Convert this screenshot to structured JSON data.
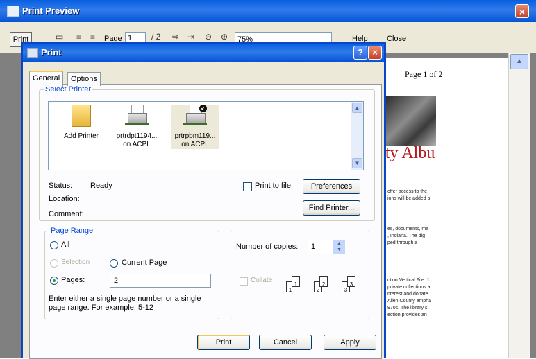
{
  "preview_window": {
    "title": "Print Preview",
    "toolbar": {
      "print_label": "Print",
      "page_label": "Page",
      "page_value": "1",
      "zoom_value": "75%",
      "help_label": "Help",
      "close_label": "Close"
    },
    "page": {
      "header": "Page 1 of 2",
      "title_fragment": "ty Albu",
      "paragraphs": [
        "offer access to the\nions will be added a",
        "es, documents, ma\n, Indiana. The dig\nped through a",
        "ction Vertical File. 1\nprivate collections a\nnterest and donate\nAllen County empha\n970s. The library s\nection provides an"
      ]
    }
  },
  "dialog": {
    "title": "Print",
    "tabs": [
      "General",
      "Options"
    ],
    "select_printer": {
      "legend": "Select Printer",
      "printers": [
        {
          "name": "Add Printer",
          "sub": ""
        },
        {
          "name": "prtrdpt1194...",
          "sub": "on ACPL"
        },
        {
          "name": "prtrpbm119...",
          "sub": "on ACPL"
        }
      ],
      "status_label": "Status:",
      "status_value": "Ready",
      "location_label": "Location:",
      "comment_label": "Comment:",
      "print_to_file_label": "Print to file",
      "preferences_label": "Preferences",
      "find_printer_label": "Find Printer..."
    },
    "page_range": {
      "legend": "Page Range",
      "all_label": "All",
      "selection_label": "Selection",
      "current_page_label": "Current Page",
      "pages_label": "Pages:",
      "pages_value": "2",
      "hint": "Enter either a single page number or a single page range.  For example, 5-12"
    },
    "copies": {
      "label": "Number of copies:",
      "value": "1",
      "collate_label": "Collate",
      "collate_numbers": [
        "1",
        "1",
        "2",
        "2",
        "3",
        "3"
      ]
    },
    "buttons": {
      "print": "Print",
      "cancel": "Cancel",
      "apply": "Apply"
    },
    "help_glyph": "?",
    "close_glyph": "×"
  }
}
